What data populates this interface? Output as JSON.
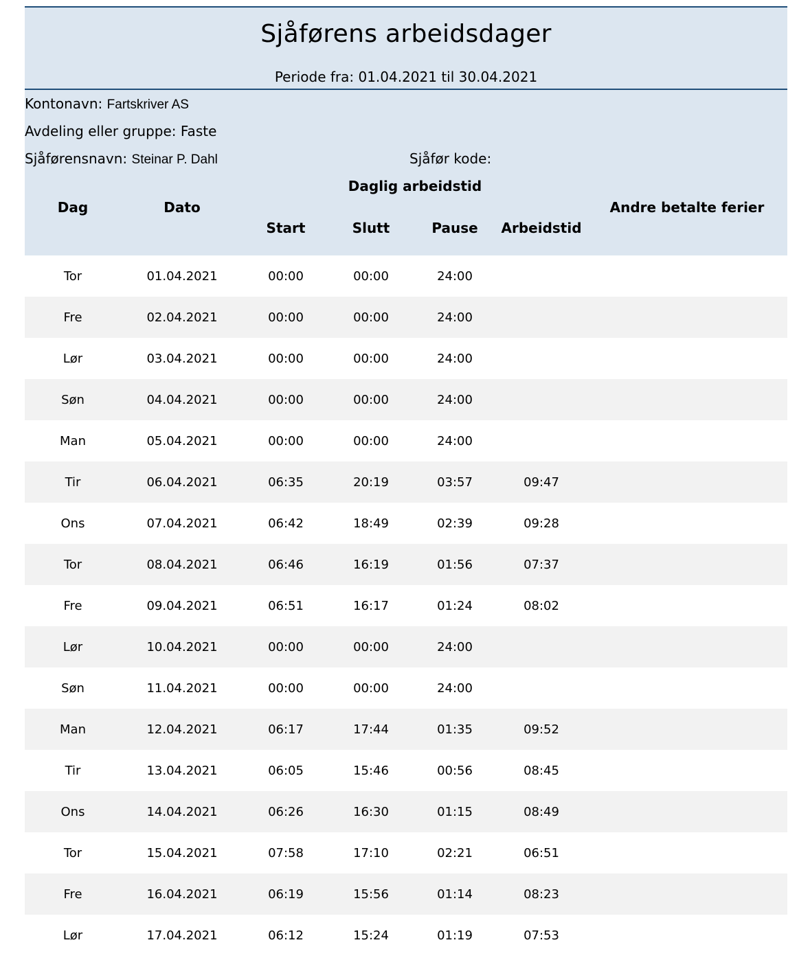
{
  "report": {
    "title": "Sjåførens arbeidsdager",
    "period": "Periode fra: 01.04.2021 til 30.04.2021"
  },
  "info": {
    "account_label": "Kontonavn:",
    "account_value": "Fartskriver AS",
    "department_label": "Avdeling eller gruppe:",
    "department_value": "Faste",
    "driver_label": "Sjåførensnavn:",
    "driver_value": "Steinar P. Dahl",
    "driver_code_label": "Sjåfør kode:"
  },
  "columns": {
    "day": "Dag",
    "date": "Dato",
    "daily_group": "Daglig arbeidstid",
    "start": "Start",
    "end": "Slutt",
    "pause": "Pause",
    "worktime": "Arbeidstid",
    "other_paid_holidays": "Andre betalte ferier"
  },
  "rows": [
    {
      "day": "Tor",
      "date": "01.04.2021",
      "start": "00:00",
      "end": "00:00",
      "pause": "24:00",
      "worktime": "",
      "other": ""
    },
    {
      "day": "Fre",
      "date": "02.04.2021",
      "start": "00:00",
      "end": "00:00",
      "pause": "24:00",
      "worktime": "",
      "other": ""
    },
    {
      "day": "Lør",
      "date": "03.04.2021",
      "start": "00:00",
      "end": "00:00",
      "pause": "24:00",
      "worktime": "",
      "other": ""
    },
    {
      "day": "Søn",
      "date": "04.04.2021",
      "start": "00:00",
      "end": "00:00",
      "pause": "24:00",
      "worktime": "",
      "other": ""
    },
    {
      "day": "Man",
      "date": "05.04.2021",
      "start": "00:00",
      "end": "00:00",
      "pause": "24:00",
      "worktime": "",
      "other": ""
    },
    {
      "day": "Tir",
      "date": "06.04.2021",
      "start": "06:35",
      "end": "20:19",
      "pause": "03:57",
      "worktime": "09:47",
      "other": ""
    },
    {
      "day": "Ons",
      "date": "07.04.2021",
      "start": "06:42",
      "end": "18:49",
      "pause": "02:39",
      "worktime": "09:28",
      "other": ""
    },
    {
      "day": "Tor",
      "date": "08.04.2021",
      "start": "06:46",
      "end": "16:19",
      "pause": "01:56",
      "worktime": "07:37",
      "other": ""
    },
    {
      "day": "Fre",
      "date": "09.04.2021",
      "start": "06:51",
      "end": "16:17",
      "pause": "01:24",
      "worktime": "08:02",
      "other": ""
    },
    {
      "day": "Lør",
      "date": "10.04.2021",
      "start": "00:00",
      "end": "00:00",
      "pause": "24:00",
      "worktime": "",
      "other": ""
    },
    {
      "day": "Søn",
      "date": "11.04.2021",
      "start": "00:00",
      "end": "00:00",
      "pause": "24:00",
      "worktime": "",
      "other": ""
    },
    {
      "day": "Man",
      "date": "12.04.2021",
      "start": "06:17",
      "end": "17:44",
      "pause": "01:35",
      "worktime": "09:52",
      "other": ""
    },
    {
      "day": "Tir",
      "date": "13.04.2021",
      "start": "06:05",
      "end": "15:46",
      "pause": "00:56",
      "worktime": "08:45",
      "other": ""
    },
    {
      "day": "Ons",
      "date": "14.04.2021",
      "start": "06:26",
      "end": "16:30",
      "pause": "01:15",
      "worktime": "08:49",
      "other": ""
    },
    {
      "day": "Tor",
      "date": "15.04.2021",
      "start": "07:58",
      "end": "17:10",
      "pause": "02:21",
      "worktime": "06:51",
      "other": ""
    },
    {
      "day": "Fre",
      "date": "16.04.2021",
      "start": "06:19",
      "end": "15:56",
      "pause": "01:14",
      "worktime": "08:23",
      "other": ""
    },
    {
      "day": "Lør",
      "date": "17.04.2021",
      "start": "06:12",
      "end": "15:24",
      "pause": "01:19",
      "worktime": "07:53",
      "other": ""
    }
  ]
}
